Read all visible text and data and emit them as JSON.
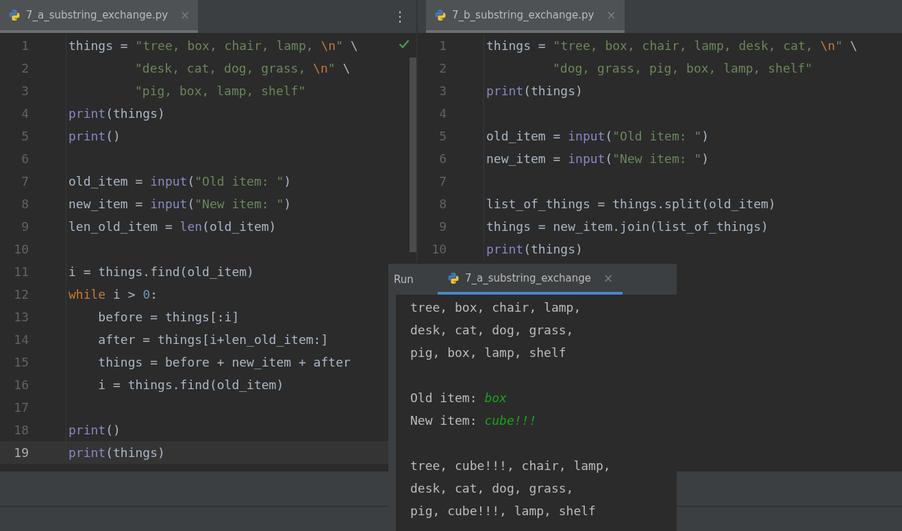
{
  "editors": [
    {
      "tab": {
        "title": "7_a_substring_exchange.py",
        "close": "×",
        "selected": true
      },
      "menu": "⋮",
      "status_check": true,
      "lines": [
        {
          "number": "1",
          "current": false,
          "kind": "code",
          "tokens": [
            {
              "kind": "plain",
              "text": "things = "
            },
            {
              "kind": "string",
              "text": "\"tree, box, chair, lamp, "
            },
            {
              "kind": "escape",
              "text": "\\n"
            },
            {
              "kind": "string",
              "text": "\""
            },
            {
              "kind": "plain",
              "text": " \\"
            }
          ]
        },
        {
          "number": "2",
          "current": false,
          "kind": "continuation",
          "tokens": [
            {
              "kind": "string",
              "text": "\"desk, cat, dog, grass, "
            },
            {
              "kind": "escape",
              "text": "\\n"
            },
            {
              "kind": "string",
              "text": "\""
            },
            {
              "kind": "plain",
              "text": " \\"
            }
          ]
        },
        {
          "number": "3",
          "current": false,
          "kind": "continuation",
          "tokens": [
            {
              "kind": "string",
              "text": "\"pig, box, lamp, shelf\""
            }
          ]
        },
        {
          "number": "4",
          "current": false,
          "kind": "code",
          "tokens": [
            {
              "kind": "builtin",
              "text": "print"
            },
            {
              "kind": "plain",
              "text": "(things)"
            }
          ]
        },
        {
          "number": "5",
          "current": false,
          "kind": "code",
          "tokens": [
            {
              "kind": "builtin",
              "text": "print"
            },
            {
              "kind": "plain",
              "text": "()"
            }
          ]
        },
        {
          "number": "6",
          "current": false,
          "kind": "code"
        },
        {
          "number": "7",
          "current": false,
          "kind": "code",
          "tokens": [
            {
              "kind": "plain",
              "text": "old_item = "
            },
            {
              "kind": "builtin",
              "text": "input"
            },
            {
              "kind": "plain",
              "text": "("
            },
            {
              "kind": "string",
              "text": "\"Old item: \""
            },
            {
              "kind": "plain",
              "text": ")"
            }
          ]
        },
        {
          "number": "8",
          "current": false,
          "kind": "code",
          "tokens": [
            {
              "kind": "plain",
              "text": "new_item = "
            },
            {
              "kind": "builtin",
              "text": "input"
            },
            {
              "kind": "plain",
              "text": "("
            },
            {
              "kind": "string",
              "text": "\"New item: \""
            },
            {
              "kind": "plain",
              "text": ")"
            }
          ]
        },
        {
          "number": "9",
          "current": false,
          "kind": "code",
          "tokens": [
            {
              "kind": "plain",
              "text": "len_old_item = "
            },
            {
              "kind": "builtin",
              "text": "len"
            },
            {
              "kind": "plain",
              "text": "(old_item)"
            }
          ]
        },
        {
          "number": "10",
          "current": false,
          "kind": "code"
        },
        {
          "number": "11",
          "current": false,
          "kind": "code",
          "tokens": [
            {
              "kind": "plain",
              "text": "i = things.find(old_item)"
            }
          ]
        },
        {
          "number": "12",
          "current": false,
          "kind": "code",
          "tokens": [
            {
              "kind": "keyword",
              "text": "while"
            },
            {
              "kind": "plain",
              "text": " i > "
            },
            {
              "kind": "number",
              "text": "0"
            },
            {
              "kind": "plain",
              "text": ":"
            }
          ]
        },
        {
          "number": "13",
          "current": false,
          "kind": "code",
          "tokens": [
            {
              "kind": "plain",
              "text": "    before = things[:i]"
            }
          ]
        },
        {
          "number": "14",
          "current": false,
          "kind": "code",
          "tokens": [
            {
              "kind": "plain",
              "text": "    after = things[i+len_old_item:]"
            }
          ]
        },
        {
          "number": "15",
          "current": false,
          "kind": "code",
          "tokens": [
            {
              "kind": "plain",
              "text": "    things = before + new_item + after"
            }
          ]
        },
        {
          "number": "16",
          "current": false,
          "kind": "code",
          "tokens": [
            {
              "kind": "plain",
              "text": "    i = things.find(old_item)"
            }
          ]
        },
        {
          "number": "17",
          "current": false,
          "kind": "code"
        },
        {
          "number": "18",
          "current": false,
          "kind": "code",
          "tokens": [
            {
              "kind": "builtin",
              "text": "print"
            },
            {
              "kind": "plain",
              "text": "()"
            }
          ]
        },
        {
          "number": "19",
          "current": true,
          "kind": "code",
          "tokens": [
            {
              "kind": "builtin",
              "text": "print"
            },
            {
              "kind": "plain",
              "text": "(things)"
            }
          ]
        }
      ]
    },
    {
      "tab": {
        "title": "7_b_substring_exchange.py",
        "close": "×",
        "selected": true
      },
      "lines": [
        {
          "number": "1",
          "current": false,
          "kind": "code",
          "tokens": [
            {
              "kind": "plain",
              "text": "things = "
            },
            {
              "kind": "string",
              "text": "\"tree, box, chair, lamp, desk, cat, "
            },
            {
              "kind": "escape",
              "text": "\\n"
            },
            {
              "kind": "string",
              "text": "\""
            },
            {
              "kind": "plain",
              "text": " \\"
            }
          ]
        },
        {
          "number": "2",
          "current": false,
          "kind": "continuation",
          "tokens": [
            {
              "kind": "string",
              "text": "\"dog, grass, pig, box, lamp, shelf\""
            }
          ]
        },
        {
          "number": "3",
          "current": false,
          "kind": "code",
          "tokens": [
            {
              "kind": "builtin",
              "text": "print"
            },
            {
              "kind": "plain",
              "text": "(things)"
            }
          ]
        },
        {
          "number": "4",
          "current": false,
          "kind": "code"
        },
        {
          "number": "5",
          "current": false,
          "kind": "code",
          "tokens": [
            {
              "kind": "plain",
              "text": "old_item = "
            },
            {
              "kind": "builtin",
              "text": "input"
            },
            {
              "kind": "plain",
              "text": "("
            },
            {
              "kind": "string",
              "text": "\"Old item: \""
            },
            {
              "kind": "plain",
              "text": ")"
            }
          ]
        },
        {
          "number": "6",
          "current": false,
          "kind": "code",
          "tokens": [
            {
              "kind": "plain",
              "text": "new_item = "
            },
            {
              "kind": "builtin",
              "text": "input"
            },
            {
              "kind": "plain",
              "text": "("
            },
            {
              "kind": "string",
              "text": "\"New item: \""
            },
            {
              "kind": "plain",
              "text": ")"
            }
          ]
        },
        {
          "number": "7",
          "current": false,
          "kind": "code"
        },
        {
          "number": "8",
          "current": false,
          "kind": "code",
          "tokens": [
            {
              "kind": "plain",
              "text": "list_of_things = things.split(old_item)"
            }
          ]
        },
        {
          "number": "9",
          "current": false,
          "kind": "code",
          "tokens": [
            {
              "kind": "plain",
              "text": "things = new_item.join(list_of_things)"
            }
          ]
        },
        {
          "number": "10",
          "current": false,
          "kind": "code",
          "tokens": [
            {
              "kind": "builtin",
              "text": "print"
            },
            {
              "kind": "plain",
              "text": "(things)"
            }
          ]
        }
      ]
    }
  ],
  "run_panel": {
    "title": "Run",
    "tab": {
      "title": "7_a_substring_exchange",
      "close": "×",
      "selected": true
    },
    "output": [
      {
        "kind": "text",
        "tokens": [
          {
            "kind": "output",
            "text": "tree, box, chair, lamp,"
          }
        ]
      },
      {
        "kind": "text",
        "tokens": [
          {
            "kind": "output",
            "text": "desk, cat, dog, grass,"
          }
        ]
      },
      {
        "kind": "text",
        "tokens": [
          {
            "kind": "output",
            "text": "pig, box, lamp, shelf"
          }
        ]
      },
      {
        "kind": "blank"
      },
      {
        "kind": "text",
        "tokens": [
          {
            "kind": "output",
            "text": "Old item: "
          },
          {
            "kind": "input",
            "text": "box"
          }
        ]
      },
      {
        "kind": "text",
        "tokens": [
          {
            "kind": "output",
            "text": "New item: "
          },
          {
            "kind": "input",
            "text": "cube!!!"
          }
        ]
      },
      {
        "kind": "blank"
      },
      {
        "kind": "text",
        "tokens": [
          {
            "kind": "output",
            "text": "tree, cube!!!, chair, lamp,"
          }
        ]
      },
      {
        "kind": "text",
        "tokens": [
          {
            "kind": "output",
            "text": "desk, cat, dog, grass,"
          }
        ]
      },
      {
        "kind": "text",
        "tokens": [
          {
            "kind": "output",
            "text": "pig, cube!!!, lamp, shelf"
          }
        ]
      }
    ]
  }
}
